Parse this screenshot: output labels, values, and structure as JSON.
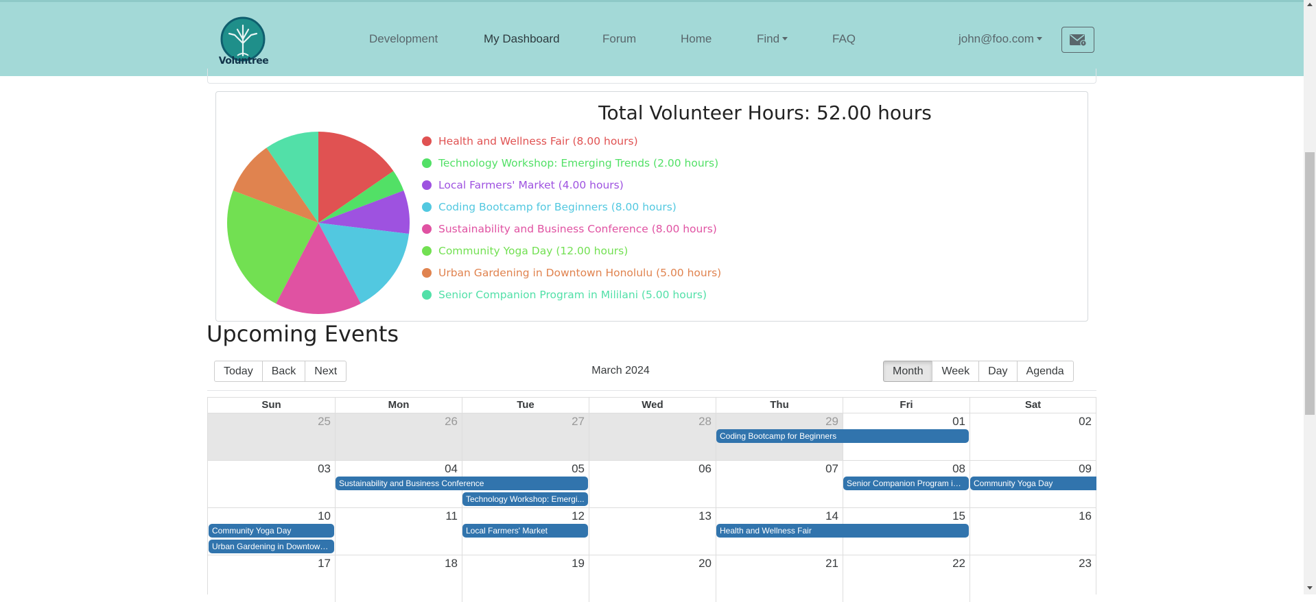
{
  "nav": {
    "brand": "Voluntree",
    "links": [
      "Development",
      "My Dashboard",
      "Forum",
      "Home",
      "Find",
      "FAQ"
    ],
    "user": "john@foo.com"
  },
  "hours": {
    "title": "Total Volunteer Hours: 52.00 hours",
    "items": [
      {
        "label": "Health and Wellness Fair (8.00 hours)",
        "hours": 8,
        "color": "#e05252"
      },
      {
        "label": "Technology Workshop: Emerging Trends (2.00 hours)",
        "hours": 2,
        "color": "#52e066"
      },
      {
        "label": "Local Farmers' Market (4.00 hours)",
        "hours": 4,
        "color": "#9e52e0"
      },
      {
        "label": "Coding Bootcamp for Beginners (8.00 hours)",
        "hours": 8,
        "color": "#52c8e0"
      },
      {
        "label": "Sustainability and Business Conference (8.00 hours)",
        "hours": 8,
        "color": "#e052a2"
      },
      {
        "label": "Community Yoga Day (12.00 hours)",
        "hours": 12,
        "color": "#72e052"
      },
      {
        "label": "Urban Gardening in Downtown Honolulu (5.00 hours)",
        "hours": 5,
        "color": "#e0834f"
      },
      {
        "label": "Senior Companion Program in Mililani (5.00 hours)",
        "hours": 5,
        "color": "#52e0a8"
      }
    ]
  },
  "chart_data": {
    "type": "pie",
    "title": "Total Volunteer Hours: 52.00 hours",
    "categories": [
      "Health and Wellness Fair",
      "Technology Workshop: Emerging Trends",
      "Local Farmers' Market",
      "Coding Bootcamp for Beginners",
      "Sustainability and Business Conference",
      "Community Yoga Day",
      "Urban Gardening in Downtown Honolulu",
      "Senior Companion Program in Mililani"
    ],
    "values": [
      8,
      2,
      4,
      8,
      8,
      12,
      5,
      5
    ],
    "legend": "right"
  },
  "events": {
    "heading": "Upcoming Events",
    "nav_buttons": [
      "Today",
      "Back",
      "Next"
    ],
    "label": "March 2024",
    "view_buttons": [
      "Month",
      "Week",
      "Day",
      "Agenda"
    ],
    "active_view": "Month",
    "weekdays": [
      "Sun",
      "Mon",
      "Tue",
      "Wed",
      "Thu",
      "Fri",
      "Sat"
    ],
    "weeks": [
      [
        "25",
        "26",
        "27",
        "28",
        "29",
        "01",
        "02"
      ],
      [
        "03",
        "04",
        "05",
        "06",
        "07",
        "08",
        "09"
      ],
      [
        "10",
        "11",
        "12",
        "13",
        "14",
        "15",
        "16"
      ],
      [
        "17",
        "18",
        "19",
        "20",
        "21",
        "22",
        "23"
      ]
    ],
    "off_range_days": 5,
    "calendar_events": [
      {
        "title": "Coding Bootcamp for Beginners",
        "display": "Coding Bootcamp for Beginners",
        "week": 0,
        "start": 4,
        "span": 2,
        "slot": 0
      },
      {
        "title": "Sustainability and Business Conference",
        "display": "Sustainability and Business Conference",
        "week": 1,
        "start": 1,
        "span": 2,
        "slot": 0
      },
      {
        "title": "Technology Workshop: Emerging Trends",
        "display": "Technology Workshop: Emergi...",
        "week": 1,
        "start": 2,
        "span": 1,
        "slot": 1
      },
      {
        "title": "Senior Companion Program in Mililani",
        "display": "Senior Companion Program in ...",
        "week": 1,
        "start": 5,
        "span": 1,
        "slot": 0
      },
      {
        "title": "Community Yoga Day",
        "display": "Community Yoga Day",
        "week": 1,
        "start": 6,
        "span": 1,
        "slot": 0,
        "continues": true
      },
      {
        "title": "Community Yoga Day",
        "display": "Community Yoga Day",
        "week": 2,
        "start": 0,
        "span": 1,
        "slot": 0
      },
      {
        "title": "Urban Gardening in Downtown Honolulu",
        "display": "Urban Gardening in Downtown ...",
        "week": 2,
        "start": 0,
        "span": 1,
        "slot": 1
      },
      {
        "title": "Local Farmers' Market",
        "display": "Local Farmers' Market",
        "week": 2,
        "start": 2,
        "span": 1,
        "slot": 0
      },
      {
        "title": "Health and Wellness Fair",
        "display": "Health and Wellness Fair",
        "week": 2,
        "start": 4,
        "span": 2,
        "slot": 0
      }
    ]
  }
}
